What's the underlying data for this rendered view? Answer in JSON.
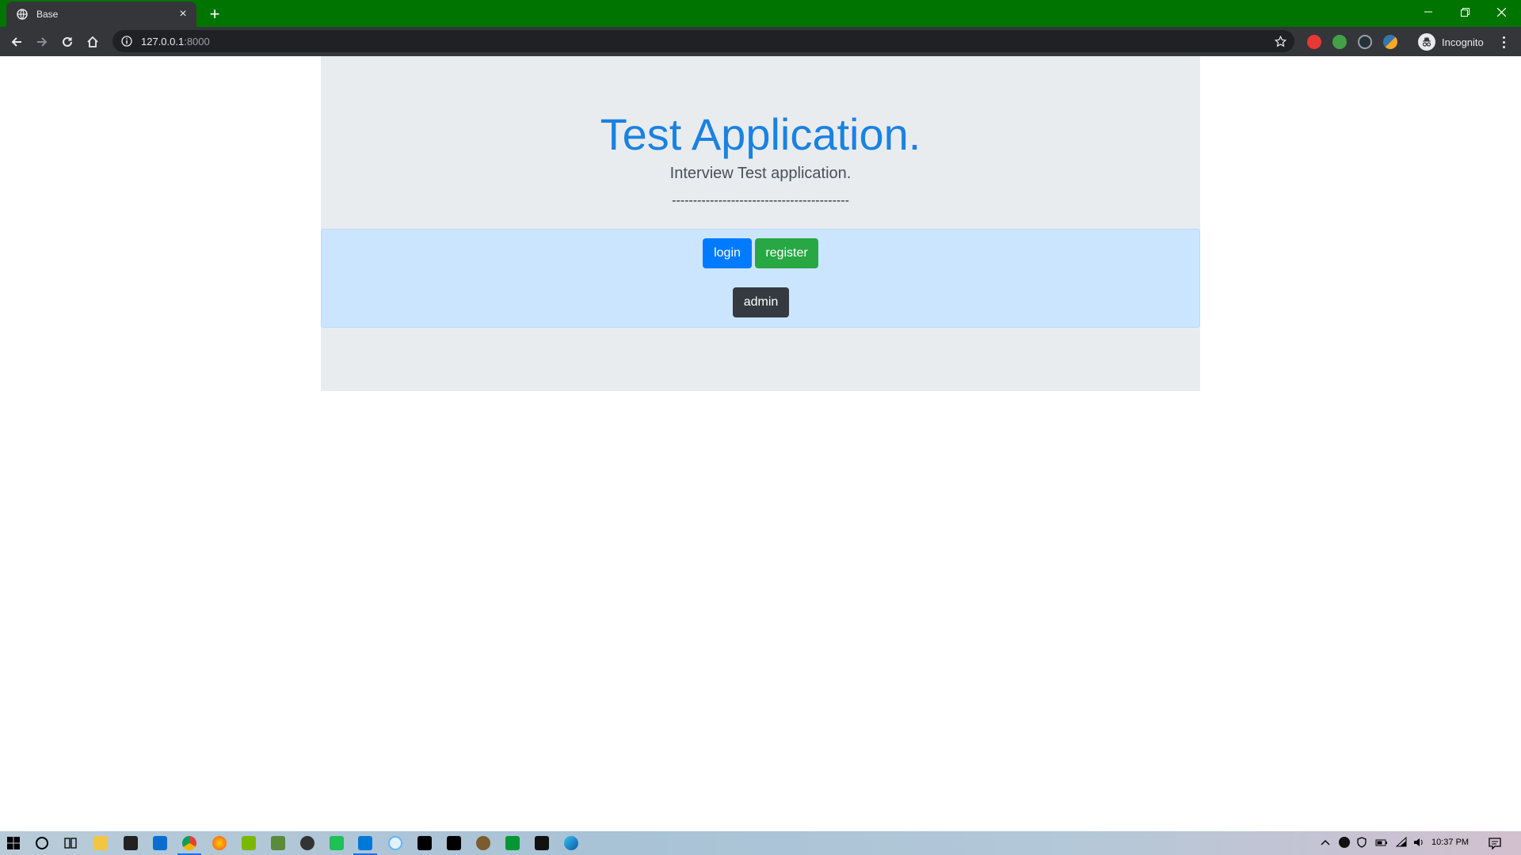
{
  "browser": {
    "tab_title": "Base",
    "url_host": "127.0.0.1",
    "url_port": ":8000",
    "profile_label": "Incognito",
    "tabbar_color": "#007400",
    "icons": {
      "favicon": "globe-icon",
      "tab_close": "close-icon",
      "new_tab": "plus-icon",
      "back": "arrow-left-icon",
      "forward": "arrow-right-icon",
      "reload": "reload-icon",
      "home": "home-icon",
      "site_info": "info-icon",
      "bookmark": "star-icon",
      "menu": "kebab-menu-icon"
    },
    "window_controls": [
      "minimize-icon",
      "restore-icon",
      "close-icon"
    ],
    "extensions": [
      {
        "name": "extension-red-icon",
        "color": "#e53935"
      },
      {
        "name": "extension-green-icon",
        "color": "#43a047"
      },
      {
        "name": "extension-dark-icon",
        "color": "#263238"
      },
      {
        "name": "extension-python-icon",
        "color": "#f9a825"
      }
    ]
  },
  "page": {
    "title": "Test Application.",
    "subtitle": "Interview Test application.",
    "divider": "------------------------------------------",
    "buttons": {
      "login": "login",
      "register": "register",
      "admin": "admin"
    },
    "colors": {
      "title": "#1a82e2",
      "login": "#007bff",
      "register": "#28a745",
      "admin": "#343a40",
      "jumbotron": "#e9ecef",
      "alert": "#cce5ff"
    }
  },
  "taskbar": {
    "time": "10:37 PM",
    "apps": [
      "windows-start-icon",
      "cortana-icon",
      "task-view-icon",
      "file-explorer-icon",
      "store-icon",
      "mail-icon",
      "chrome-icon",
      "firefox-icon",
      "utorrent-icon",
      "app-icon",
      "obs-icon",
      "line-icon",
      "vscode-icon",
      "app-icon",
      "pycharm-icon",
      "webstorm-icon",
      "app-icon",
      "vim-icon",
      "calculator-icon",
      "edge-icon"
    ],
    "tray": [
      "chevron-up-icon",
      "app-icon",
      "security-icon",
      "battery-icon",
      "wifi-icon",
      "volume-icon"
    ]
  }
}
